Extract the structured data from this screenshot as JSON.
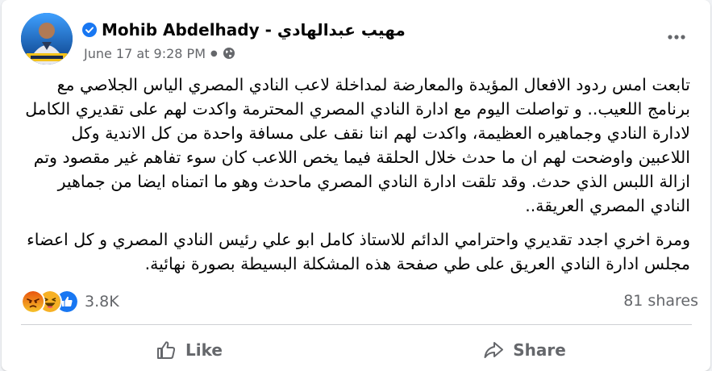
{
  "post": {
    "author": "Mohib Abdelhady - مهيب عبدالهادي",
    "date": "June 17 at 9:28 PM",
    "visibility_icon": "globe-icon",
    "paragraphs": [
      "تابعت امس ردود الافعال المؤيدة والمعارضة لمداخلة لاعب النادي المصري الياس الجلاصي مع برنامج اللعيب.. و تواصلت اليوم مع ادارة النادي المصري المحترمة واكدت لهم على تقديري الكامل لادارة النادي وجماهيره العظيمة، واكدت لهم اننا نقف على مسافة واحدة من كل الاندية وكل اللاعبين واوضحت لهم ان ما حدث خلال الحلقة فيما يخص اللاعب كان سوء تفاهم غير مقصود وتم ازالة اللبس الذي حدث. وقد تلقت ادارة النادي المصري ماحدث وهو ما اتمناه ايضا من جماهير النادي المصري العريقة..",
      "ومرة اخري اجدد تقديري واحترامي الدائم للاستاذ كامل ابو علي رئيس النادي المصري و كل اعضاء مجلس ادارة النادي العريق على طي صفحة هذه المشكلة البسيطة بصورة نهائية."
    ]
  },
  "reactions": {
    "count": "3.8K",
    "types": [
      "angry",
      "haha",
      "like"
    ],
    "shares": "81 shares"
  },
  "actions": {
    "like_label": "Like",
    "share_label": "Share"
  },
  "colors": {
    "like_blue": "#1877f2",
    "angry_orange": "#e9710f",
    "haha_yellow": "#f7b125",
    "secondary_text": "#65676b"
  }
}
